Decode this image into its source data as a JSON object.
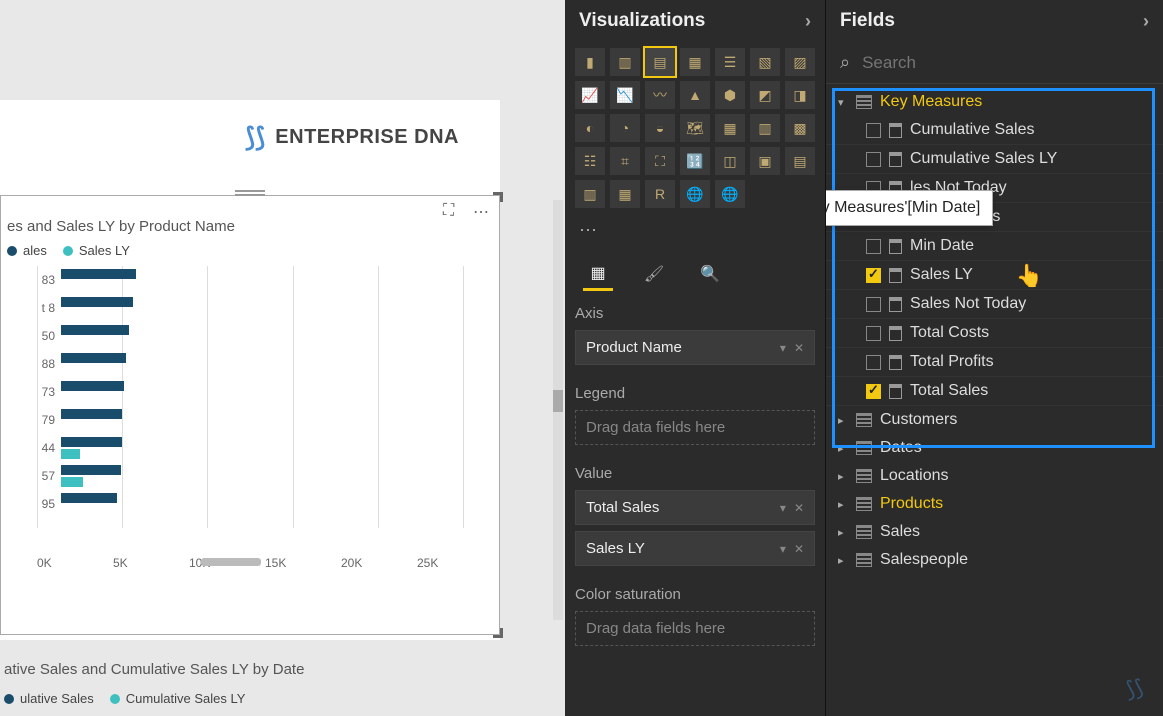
{
  "logo": {
    "text": "ENTERPRISE DNA"
  },
  "chart1": {
    "title": "es and Sales LY by Product Name",
    "legend": [
      "ales",
      "Sales LY"
    ]
  },
  "chart_data": {
    "type": "bar",
    "title": "es and Sales LY by Product Name",
    "xlabel": "",
    "ylabel": "",
    "x_ticks": [
      "0K",
      "5K",
      "10K",
      "15K",
      "20K",
      "25K"
    ],
    "xlim": [
      0,
      27000
    ],
    "categories": [
      "83",
      "t 8",
      "50",
      "88",
      "73",
      "79",
      "44",
      "57",
      "95"
    ],
    "series": [
      {
        "name": "ales",
        "values": [
          4400,
          4200,
          4000,
          3800,
          3700,
          3600,
          3600,
          3500,
          3300
        ]
      },
      {
        "name": "Sales LY",
        "values": [
          0,
          0,
          0,
          0,
          0,
          0,
          1100,
          1300,
          0
        ]
      }
    ],
    "colors": {
      "ales": "#1a4d6b",
      "Sales LY": "#3fc0c0"
    }
  },
  "chart2": {
    "title": "ative Sales and Cumulative Sales LY by Date",
    "legend": [
      "ulative Sales",
      "Cumulative Sales LY"
    ]
  },
  "visualizations": {
    "header": "Visualizations",
    "tabs": {
      "fields": "Fields",
      "format": "Format",
      "analytics": "Analytics"
    },
    "wells": {
      "axis": {
        "label": "Axis",
        "items": [
          "Product Name"
        ]
      },
      "legend": {
        "label": "Legend",
        "placeholder": "Drag data fields here"
      },
      "value": {
        "label": "Value",
        "items": [
          "Total Sales",
          "Sales LY"
        ]
      },
      "color": {
        "label": "Color saturation",
        "placeholder": "Drag data fields here"
      }
    }
  },
  "fields": {
    "header": "Fields",
    "search_placeholder": "Search",
    "tooltip": "'Key Measures'[Min Date]",
    "tables": {
      "key_measures": {
        "name": "Key Measures",
        "measures": [
          {
            "name": "Cumulative Sales",
            "checked": false
          },
          {
            "name": "Cumulative Sales LY",
            "checked": false
          },
          {
            "name": "les Not Today",
            "checked": false,
            "obscured": true
          },
          {
            "name": "Diff. In Sales",
            "checked": false,
            "obscured": true
          },
          {
            "name": "Min Date",
            "checked": false
          },
          {
            "name": "Sales LY",
            "checked": true
          },
          {
            "name": "Sales Not Today",
            "checked": false
          },
          {
            "name": "Total Costs",
            "checked": false
          },
          {
            "name": "Total Profits",
            "checked": false
          },
          {
            "name": "Total Sales",
            "checked": true
          }
        ]
      },
      "others": [
        "Customers",
        "Dates",
        "Locations",
        "Products",
        "Sales",
        "Salespeople"
      ],
      "highlighted_other": "Products"
    }
  }
}
